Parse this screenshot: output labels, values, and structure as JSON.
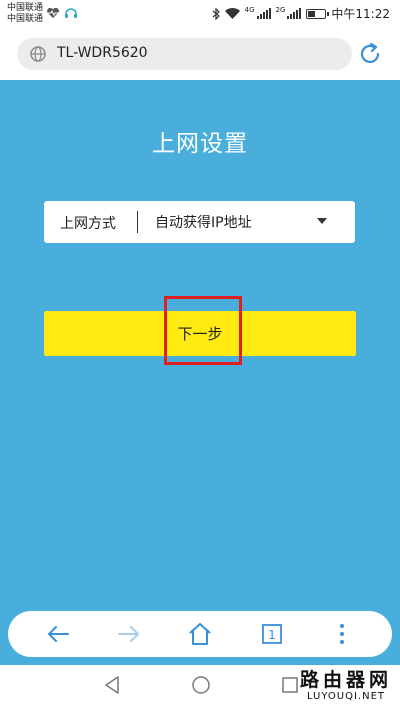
{
  "status_bar": {
    "carrier_1": "中国联通",
    "carrier_2": "中国联通",
    "network_1": "4G",
    "network_2": "2G",
    "battery_level": 0.45,
    "time": "中午11:22"
  },
  "browser": {
    "url": "TL-WDR5620"
  },
  "page": {
    "title": "上网设置",
    "connection_type_label": "上网方式",
    "connection_type_value": "自动获得IP地址",
    "next_button_label": "下一步"
  },
  "toolbar": {
    "tabs_count": "1",
    "accent_color": "#3a8fd9"
  },
  "watermark": {
    "name": "路由器网",
    "domain": "LUYOUQI.NET"
  }
}
